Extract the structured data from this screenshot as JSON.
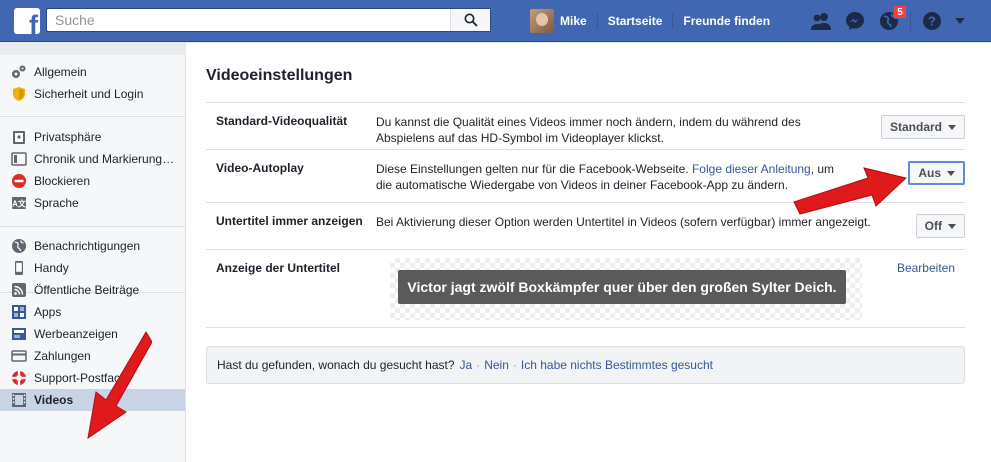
{
  "header": {
    "search_placeholder": "Suche",
    "user_name": "Mike",
    "nav_home": "Startseite",
    "nav_friends": "Freunde finden",
    "notification_count": "5",
    "brand_color": "#4267b2"
  },
  "sidebar": {
    "groups": [
      [
        {
          "label": "Allgemein",
          "icon": "gears-icon"
        },
        {
          "label": "Sicherheit und Login",
          "icon": "shield-icon"
        }
      ],
      [
        {
          "label": "Privatsphäre",
          "icon": "lock-icon"
        },
        {
          "label": "Chronik und Markierung…",
          "icon": "timeline-icon"
        },
        {
          "label": "Blockieren",
          "icon": "block-icon"
        },
        {
          "label": "Sprache",
          "icon": "language-icon"
        }
      ],
      [
        {
          "label": "Benachrichtigungen",
          "icon": "globe-icon"
        },
        {
          "label": "Handy",
          "icon": "phone-icon"
        },
        {
          "label": "Öffentliche Beiträge",
          "icon": "rss-icon"
        }
      ],
      [
        {
          "label": "Apps",
          "icon": "apps-icon"
        },
        {
          "label": "Werbeanzeigen",
          "icon": "ads-icon"
        },
        {
          "label": "Zahlungen",
          "icon": "card-icon"
        },
        {
          "label": "Support-Postfach",
          "icon": "lifebuoy-icon"
        },
        {
          "label": "Videos",
          "icon": "film-icon",
          "active": true
        }
      ]
    ]
  },
  "main": {
    "title": "Videoeinstellungen",
    "rows": {
      "quality": {
        "label": "Standard-Videoqualität",
        "desc": "Du kannst die Qualität eines Videos immer noch ändern, indem du während des Abspielens auf das HD-Symbol im Videoplayer klickst.",
        "value": "Standard"
      },
      "autoplay": {
        "label": "Video-Autoplay",
        "desc_before": "Diese Einstellungen gelten nur für die Facebook-Webseite. ",
        "desc_link": "Folge dieser Anleitung",
        "desc_after": ", um die automatische Wiedergabe von Videos in deiner Facebook-App zu ändern.",
        "value": "Aus"
      },
      "subtitles": {
        "label": "Untertitel immer anzeigen",
        "desc": "Bei Aktivierung dieser Option werden Untertitel in Videos (sofern verfügbar) immer angezeigt.",
        "value": "Off"
      },
      "subtitle_display": {
        "label": "Anzeige der Untertitel",
        "preview_text": "Victor jagt zwölf Boxkämpfer quer über den großen Sylter Deich.",
        "edit": "Bearbeiten"
      }
    },
    "feedback": {
      "question": "Hast du gefunden, wonach du gesucht hast?",
      "yes": "Ja",
      "no": "Nein",
      "nothing": "Ich habe nichts Bestimmtes gesucht"
    }
  },
  "annotation_color": "#e0191b"
}
